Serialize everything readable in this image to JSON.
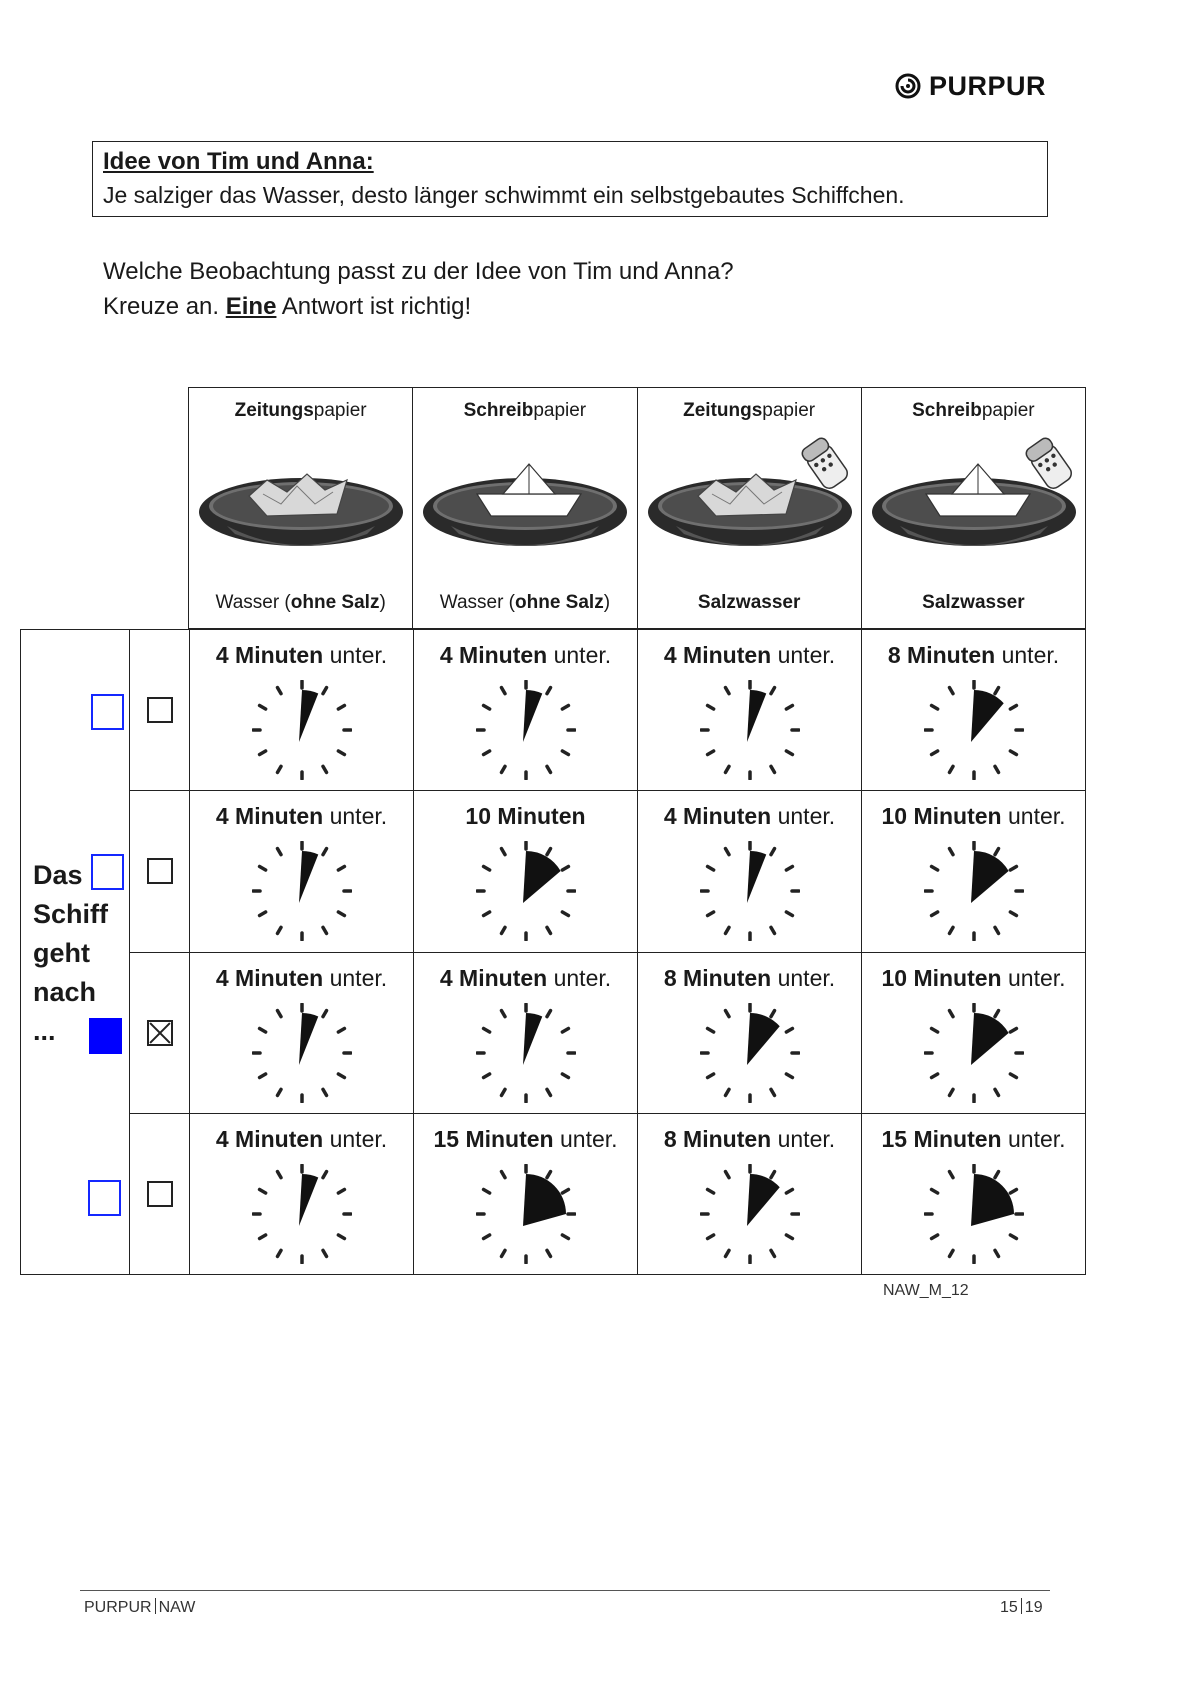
{
  "header": {
    "brand": "PURPUR"
  },
  "idea": {
    "title": "Idee von Tim und Anna:",
    "text": "Je salziger das Wasser, desto länger schwimmt ein selbstgebautes Schiffchen."
  },
  "question": {
    "line1": "Welche Beobachtung passt zu der Idee von Tim und Anna?",
    "line2_prefix": "Kreuze an. ",
    "line2_emph": "Eine",
    "line2_suffix": " Antwort ist richtig!"
  },
  "conditions": [
    {
      "paper_bold": "Zeitungs",
      "paper_rest": "papier",
      "water_plain": "Wasser (",
      "water_bold": "ohne Salz",
      "water_end": ")",
      "salt": false,
      "boat": "crumpled"
    },
    {
      "paper_bold": "Schreib",
      "paper_rest": "papier",
      "water_plain": "Wasser (",
      "water_bold": "ohne Salz",
      "water_end": ")",
      "salt": false,
      "boat": "folded"
    },
    {
      "paper_bold": "Zeitungs",
      "paper_rest": "papier",
      "water_plain": "",
      "water_bold": "Salzwasser",
      "water_end": "",
      "salt": true,
      "boat": "crumpled"
    },
    {
      "paper_bold": "Schreib",
      "paper_rest": "papier",
      "water_plain": "",
      "water_bold": "Salzwasser",
      "water_end": "",
      "salt": true,
      "boat": "folded"
    }
  ],
  "row_label": {
    "line1": "Das",
    "line2": "Schiff",
    "line3": "geht",
    "line4": "nach",
    "line5": "..."
  },
  "rows": [
    {
      "checked": false,
      "marked": false,
      "cells": [
        {
          "num": "4",
          "unit": "Minuten",
          "rest": " unter.",
          "minutes": 4
        },
        {
          "num": "4",
          "unit": "Minuten",
          "rest": " unter.",
          "minutes": 4
        },
        {
          "num": "4",
          "unit": "Minuten",
          "rest": " unter.",
          "minutes": 4
        },
        {
          "num": "8",
          "unit": "Minuten",
          "rest": " unter.",
          "minutes": 8
        }
      ]
    },
    {
      "checked": false,
      "marked": false,
      "cells": [
        {
          "num": "4",
          "unit": "Minuten",
          "rest": " unter.",
          "minutes": 4
        },
        {
          "num": "10",
          "unit": "Minuten",
          "rest": "",
          "minutes": 10
        },
        {
          "num": "4",
          "unit": "Minuten",
          "rest": " unter.",
          "minutes": 4
        },
        {
          "num": "10",
          "unit": "Minuten",
          "rest": " unter.",
          "minutes": 10
        }
      ]
    },
    {
      "checked": true,
      "marked": true,
      "cells": [
        {
          "num": "4",
          "unit": "Minuten",
          "rest": " unter.",
          "minutes": 4
        },
        {
          "num": "4",
          "unit": "Minuten",
          "rest": " unter.",
          "minutes": 4
        },
        {
          "num": "8",
          "unit": "Minuten",
          "rest": " unter.",
          "minutes": 8
        },
        {
          "num": "10",
          "unit": "Minuten",
          "rest": " unter.",
          "minutes": 10
        }
      ]
    },
    {
      "checked": false,
      "marked": false,
      "cells": [
        {
          "num": "4",
          "unit": "Minuten",
          "rest": " unter.",
          "minutes": 4
        },
        {
          "num": "15",
          "unit": "Minuten",
          "rest": " unter.",
          "minutes": 15
        },
        {
          "num": "8",
          "unit": "Minuten",
          "rest": " unter.",
          "minutes": 8
        },
        {
          "num": "15",
          "unit": "Minuten",
          "rest": " unter.",
          "minutes": 15
        }
      ]
    }
  ],
  "item_code": "NAW_M_12",
  "footer": {
    "left_a": "PURPUR",
    "left_b": "NAW",
    "page": "15",
    "total": "19"
  },
  "colors": {
    "annotation_blue": "#0000ff",
    "ink": "#1a1a1a"
  },
  "icons": [
    "purpur-logo-icon",
    "bowl-icon",
    "paper-boat-icon",
    "salt-shaker-icon",
    "clock-icon",
    "checkbox-icon"
  ]
}
